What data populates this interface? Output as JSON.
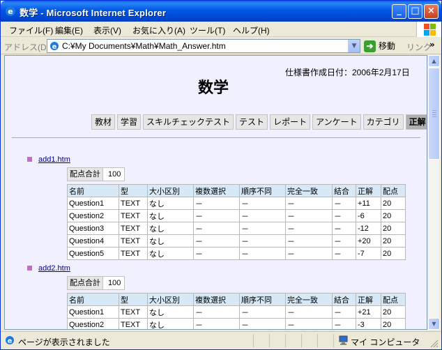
{
  "window": {
    "title": "数学 - Microsoft Internet Explorer"
  },
  "menu": [
    "ファイル(F)",
    "編集(E)",
    "表示(V)",
    "お気に入り(A)",
    "ツール(T)",
    "ヘルプ(H)"
  ],
  "address": {
    "label": "アドレス(D)",
    "url": "C:¥My Documents¥Math¥Math_Answer.htm",
    "go_label": "移動",
    "links_label": "リンク",
    "more_label": "»"
  },
  "page": {
    "date": "仕様書作成日付：2006年2月17日",
    "title": "数学",
    "nav": [
      {
        "label": "教材",
        "active": false
      },
      {
        "label": "学習",
        "active": false
      },
      {
        "label": "スキルチェックテスト",
        "active": false
      },
      {
        "label": "テスト",
        "active": false
      },
      {
        "label": "レポート",
        "active": false
      },
      {
        "label": "アンケート",
        "active": false
      },
      {
        "label": "カテゴリ",
        "active": false
      },
      {
        "label": "正解",
        "active": true
      }
    ],
    "columns": [
      "名前",
      "型",
      "大小区別",
      "複数選択",
      "順序不同",
      "完全一致",
      "結合",
      "正解",
      "配点"
    ],
    "score_label": "配点合計",
    "files": [
      {
        "name": "add1.htm",
        "total": "100",
        "rows": [
          [
            "Question1",
            "TEXT",
            "なし",
            "－",
            "－",
            "－",
            "－",
            "+11",
            "20"
          ],
          [
            "Question2",
            "TEXT",
            "なし",
            "－",
            "－",
            "－",
            "－",
            "-6",
            "20"
          ],
          [
            "Question3",
            "TEXT",
            "なし",
            "－",
            "－",
            "－",
            "－",
            "-12",
            "20"
          ],
          [
            "Question4",
            "TEXT",
            "なし",
            "－",
            "－",
            "－",
            "－",
            "+20",
            "20"
          ],
          [
            "Question5",
            "TEXT",
            "なし",
            "－",
            "－",
            "－",
            "－",
            "-7",
            "20"
          ]
        ]
      },
      {
        "name": "add2.htm",
        "total": "100",
        "rows": [
          [
            "Question1",
            "TEXT",
            "なし",
            "－",
            "－",
            "－",
            "－",
            "+21",
            "20"
          ],
          [
            "Question2",
            "TEXT",
            "なし",
            "－",
            "－",
            "－",
            "－",
            "-3",
            "20"
          ]
        ]
      }
    ]
  },
  "status": {
    "text": "ページが表示されました",
    "zone": "マイ コンピュータ"
  },
  "colors": {
    "titlebar": "#0058e6",
    "content_bg": "#f0f0ff",
    "bullet": "#cc66cc",
    "table_header": "#d7e9f7"
  }
}
